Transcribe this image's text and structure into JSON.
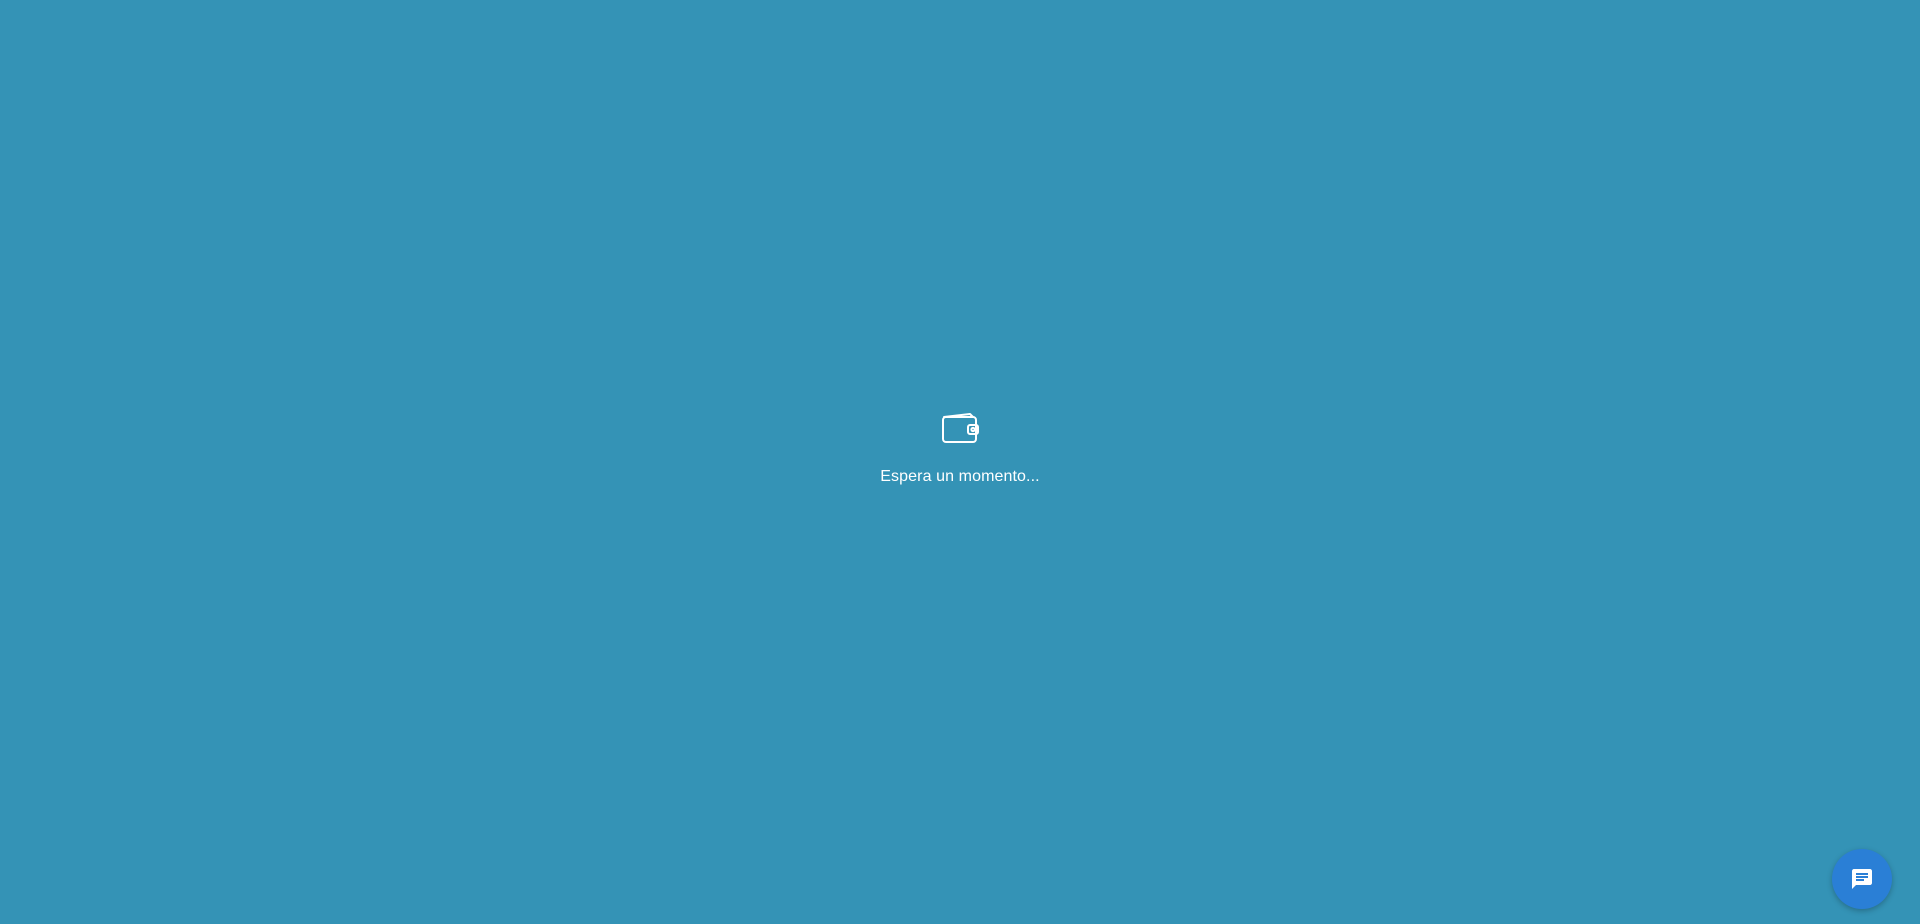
{
  "loading": {
    "message": "Espera un momento...",
    "icon": "wallet-icon"
  },
  "chat": {
    "icon": "chat-icon",
    "accent_color": "#2a7fd6"
  },
  "theme": {
    "background": "#3493b6"
  }
}
